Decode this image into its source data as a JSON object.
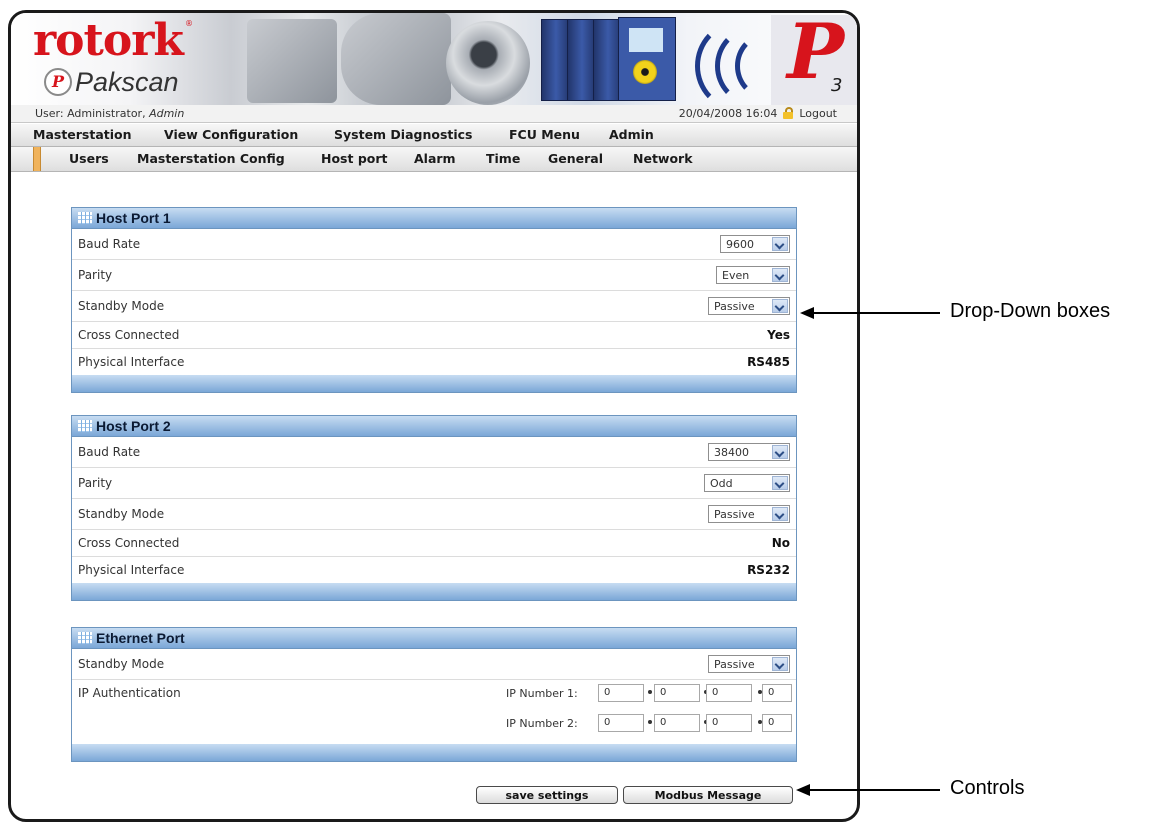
{
  "header": {
    "brand_name": "rotork",
    "brand_mark": "®",
    "product_badge": "P",
    "product_name": "Pakscan",
    "p3_letter": "P",
    "p3_number": "3"
  },
  "status": {
    "user_prefix": "User: Administrator,",
    "user_role": "Admin",
    "datetime": "20/04/2008 16:04",
    "logout_label": "Logout"
  },
  "menu_main": [
    "Masterstation",
    "View Configuration",
    "System Diagnostics",
    "FCU Menu",
    "Admin"
  ],
  "menu_sub": [
    "Users",
    "Masterstation Config",
    "Host port",
    "Alarm",
    "Time",
    "General",
    "Network"
  ],
  "host_port_1": {
    "title": "Host Port 1",
    "baud_rate_label": "Baud Rate",
    "baud_rate_value": "9600",
    "parity_label": "Parity",
    "parity_value": "Even",
    "standby_label": "Standby Mode",
    "standby_value": "Passive",
    "cross_label": "Cross Connected",
    "cross_value": "Yes",
    "interface_label": "Physical Interface",
    "interface_value": "RS485"
  },
  "host_port_2": {
    "title": "Host Port 2",
    "baud_rate_label": "Baud Rate",
    "baud_rate_value": "38400",
    "parity_label": "Parity",
    "parity_value": "Odd",
    "standby_label": "Standby Mode",
    "standby_value": "Passive",
    "cross_label": "Cross Connected",
    "cross_value": "No",
    "interface_label": "Physical Interface",
    "interface_value": "RS232"
  },
  "ethernet_port": {
    "title": "Ethernet Port",
    "standby_label": "Standby Mode",
    "standby_value": "Passive",
    "ip_auth_label": "IP Authentication",
    "ip1_label": "IP Number 1:",
    "ip1": [
      "0",
      "0",
      "0",
      "0"
    ],
    "ip2_label": "IP Number 2:",
    "ip2": [
      "0",
      "0",
      "0",
      "0"
    ]
  },
  "controls": {
    "save_label": "save settings",
    "modbus_label": "Modbus Message"
  },
  "annotations": {
    "dropdown": "Drop-Down boxes",
    "controls": "Controls"
  },
  "colors": {
    "brand_red": "#d7141c",
    "section_blue": "#7ba7d7",
    "menu_marker": "#f0b35c"
  },
  "icons": [
    "lock-icon",
    "grid-icon",
    "chevron-down-icon"
  ]
}
